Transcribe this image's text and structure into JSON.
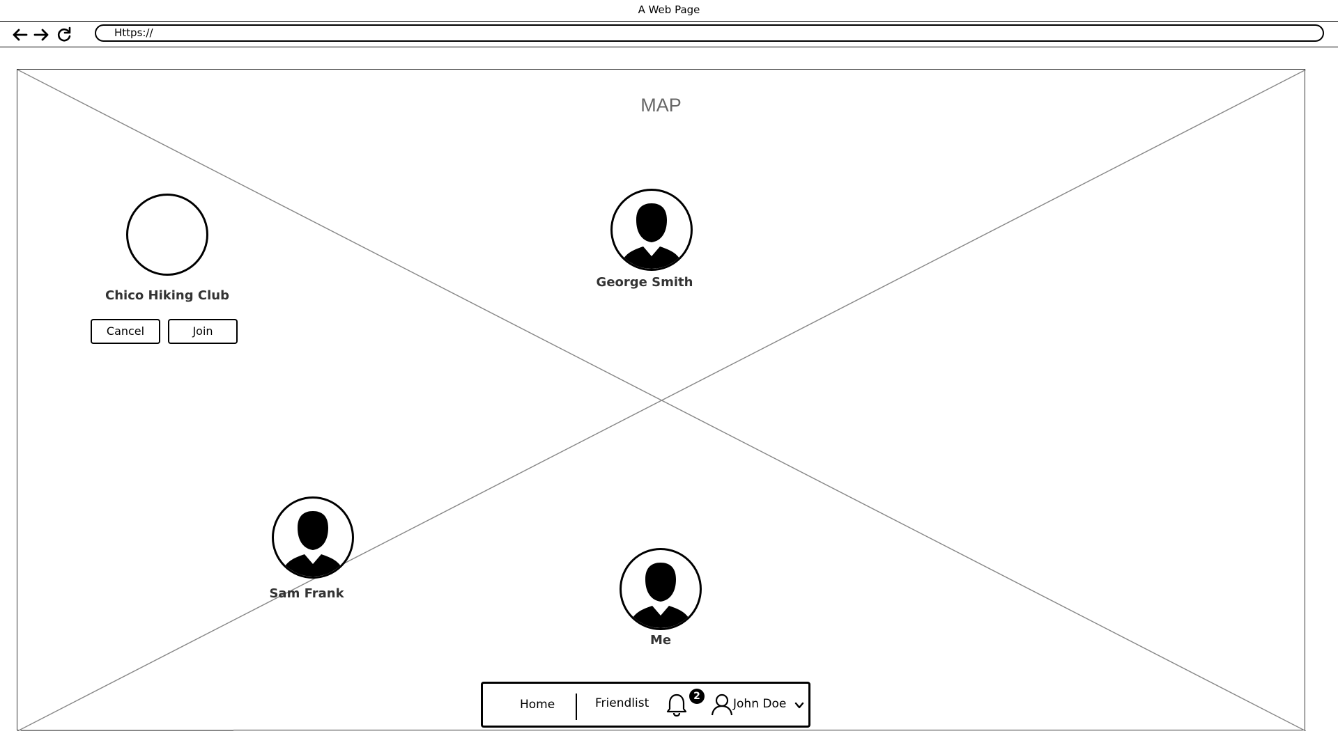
{
  "window": {
    "title": "A Web Page"
  },
  "browser": {
    "url": "Https://",
    "back_icon": "arrow-left-icon",
    "forward_icon": "arrow-right-icon",
    "reload_icon": "reload-icon"
  },
  "map": {
    "label": "MAP"
  },
  "group": {
    "name": "Chico Hiking Club",
    "cancel_label": "Cancel",
    "join_label": "Join"
  },
  "people": [
    {
      "name": "George Smith"
    },
    {
      "name": "Sam Frank"
    },
    {
      "name": "Me"
    }
  ],
  "bottom_nav": {
    "home_label": "Home",
    "friendlist_label": "Friendlist",
    "notification_count": "2",
    "user_name": "John Doe",
    "bell_icon": "bell-icon",
    "user_icon": "user-icon",
    "dropdown_icon": "chevron-down-icon"
  }
}
